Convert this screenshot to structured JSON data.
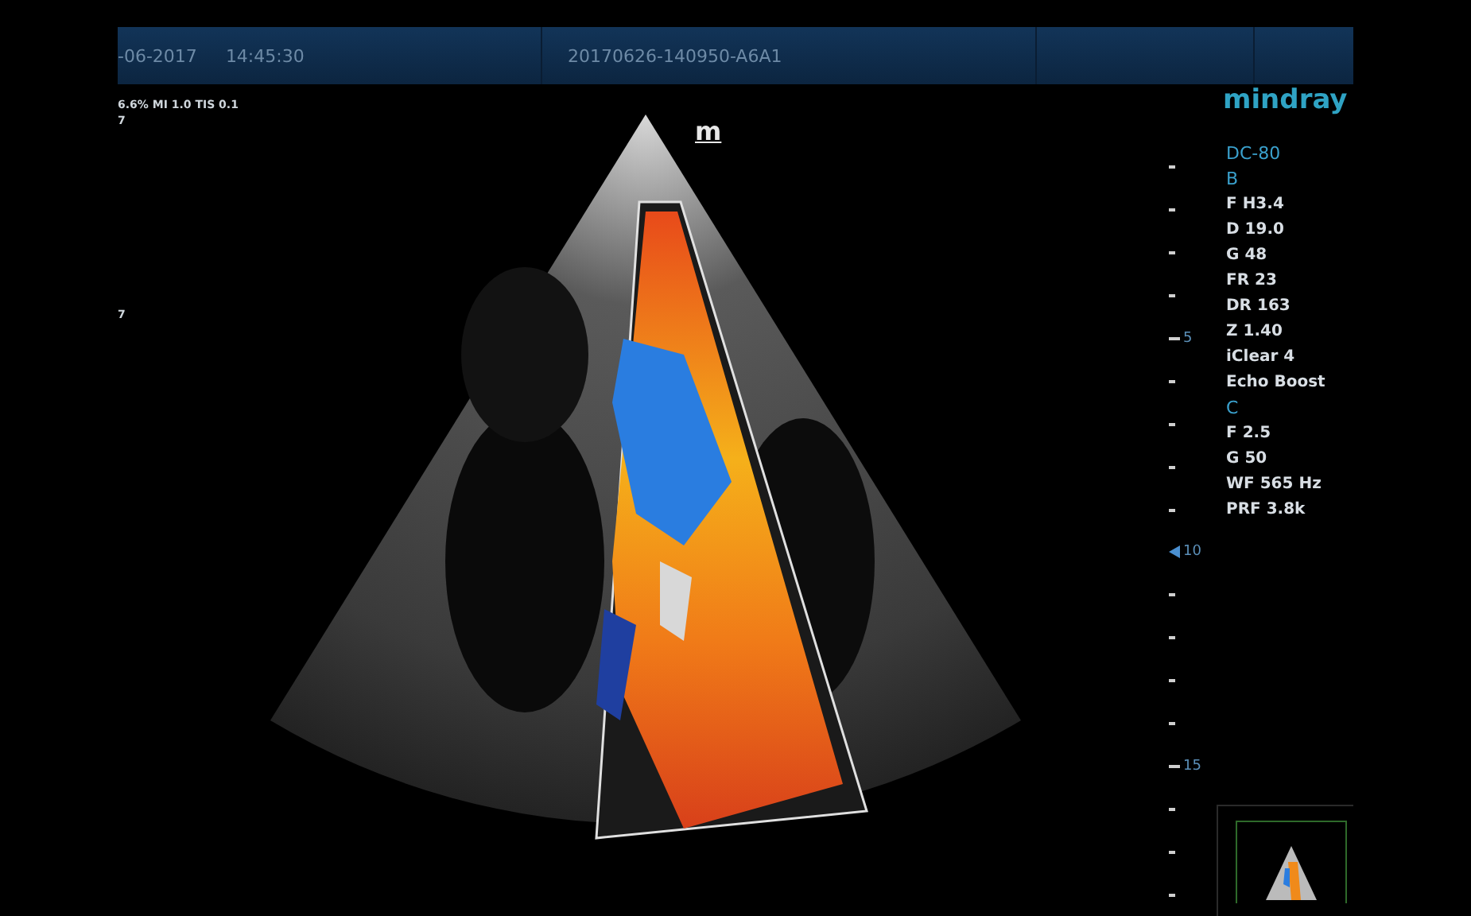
{
  "top_bar": {
    "date": "-06-2017",
    "time": "14:45:30",
    "exam_id": "20170626-140950-A6A1"
  },
  "left_info": [
    {
      "text": "6.6% MI 1.0 TIS 0.1"
    },
    {
      "text": "7"
    },
    {
      "text": "7"
    }
  ],
  "image": {
    "orientation_marker": "m"
  },
  "depth_scale": [
    {
      "label": "5",
      "focus": false
    },
    {
      "label": "10",
      "focus": true
    },
    {
      "label": "15",
      "focus": false
    }
  ],
  "logo": "mindray",
  "parameters": [
    {
      "kind": "header",
      "text": "DC-80"
    },
    {
      "kind": "header",
      "text": "B"
    },
    {
      "kind": "param",
      "text": "F H3.4"
    },
    {
      "kind": "param",
      "text": "D 19.0"
    },
    {
      "kind": "param",
      "text": "G 48"
    },
    {
      "kind": "param",
      "text": "FR 23"
    },
    {
      "kind": "param",
      "text": "DR 163"
    },
    {
      "kind": "param",
      "text": "Z 1.40"
    },
    {
      "kind": "param",
      "text": "iClear 4"
    },
    {
      "kind": "param",
      "text": "Echo Boost"
    },
    {
      "kind": "header",
      "text": "C"
    },
    {
      "kind": "param",
      "text": "F 2.5"
    },
    {
      "kind": "param",
      "text": "G 50"
    },
    {
      "kind": "param",
      "text": "WF 565 Hz"
    },
    {
      "kind": "param",
      "text": "PRF 3.8k"
    }
  ]
}
